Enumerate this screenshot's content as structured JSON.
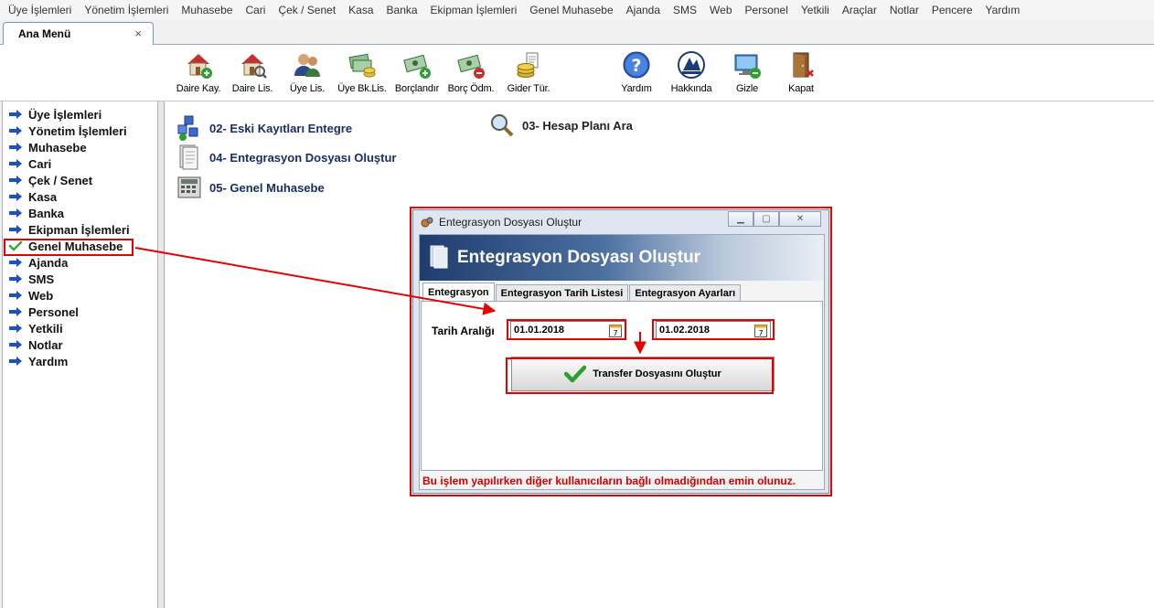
{
  "menubar": {
    "items": [
      "Üye İşlemleri",
      "Yönetim İşlemleri",
      "Muhasebe",
      "Cari",
      "Çek / Senet",
      "Kasa",
      "Banka",
      "Ekipman İşlemleri",
      "Genel Muhasebe",
      "Ajanda",
      "SMS",
      "Web",
      "Personel",
      "Yetkili",
      "Araçlar",
      "Notlar",
      "Pencere",
      "Yardım"
    ]
  },
  "tab": {
    "label": "Ana Menü",
    "close": "×"
  },
  "toolbar": {
    "daire_kay": "Daire Kay.",
    "daire_lis": "Daire Lis.",
    "uye_lis": "Üye Lis.",
    "uye_bk_lis": "Üye Bk.Lis.",
    "borclandir": "Borçlandır",
    "borc_odm": "Borç Ödm.",
    "gider_tur": "Gider Tür.",
    "yardim": "Yardım",
    "hakkinda": "Hakkında",
    "gizle": "Gizle",
    "kapat": "Kapat"
  },
  "sidebar": {
    "items": [
      "Üye İşlemleri",
      "Yönetim İşlemleri",
      "Muhasebe",
      "Cari",
      "Çek / Senet",
      "Kasa",
      "Banka",
      "Ekipman İşlemleri",
      "Genel Muhasebe",
      "Ajanda",
      "SMS",
      "Web",
      "Personel",
      "Yetkili",
      "Notlar",
      "Yardım"
    ],
    "selected_index": 8
  },
  "main": {
    "link1": "02- Eski Kayıtları Entegre",
    "link2": "04- Entegrasyon Dosyası Oluştur",
    "link3": "05- Genel Muhasebe",
    "link4": "03- Hesap Planı Ara"
  },
  "dialog": {
    "title": "Entegrasyon Dosyası Oluştur",
    "banner": "Entegrasyon Dosyası Oluştur",
    "tabs": [
      "Entegrasyon",
      "Entegrasyon Tarih Listesi",
      "Entegrasyon Ayarları"
    ],
    "active_tab": 0,
    "date_label": "Tarih Aralığı",
    "date_from": "01.01.2018",
    "date_to": "01.02.2018",
    "calendar_day": "7",
    "transfer_button": "Transfer Dosyasını Oluştur",
    "warning": "Bu işlem yapılırken diğer kullanıcıların bağlı olmadığından emin olunuz."
  },
  "colors": {
    "highlight": "#e60000",
    "link": "#1a2e66",
    "warning": "#d40000",
    "arrow_blue": "#1f4fc4"
  },
  "icons": {
    "sidebar_arrow": "right-arrow-icon",
    "sidebar_selected": "check-icon"
  }
}
